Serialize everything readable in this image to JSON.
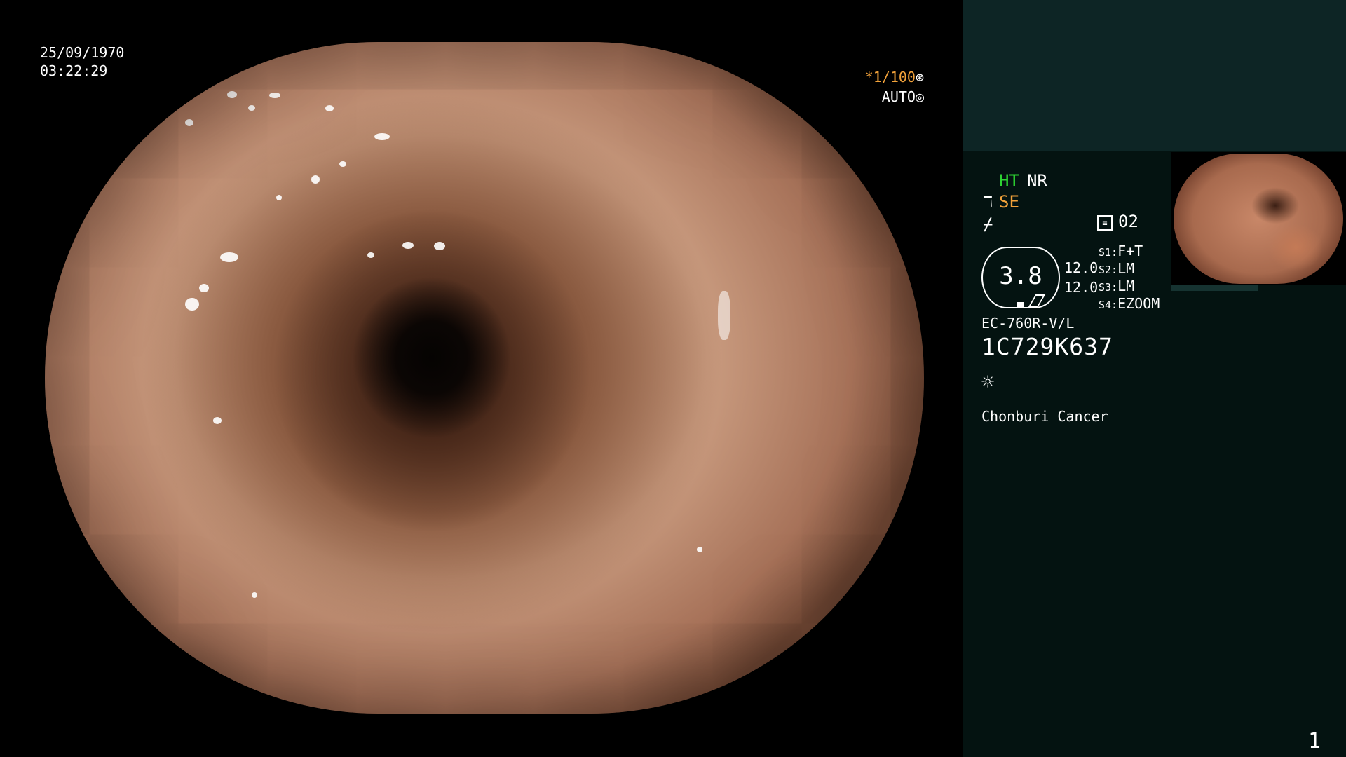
{
  "viewport": {
    "date": "25/09/1970",
    "time": "03:22:29",
    "shutter": "*1/100",
    "shutter_icon": "⊛",
    "auto_label": "AUTO",
    "auto_icon": "◎"
  },
  "panel": {
    "ht": "HT",
    "nr": "NR",
    "se_icon": "ℸ",
    "se": "SE",
    "f_icon": "⌿",
    "mode_icon": "≡",
    "mode_value": "02",
    "gauge_value": "3.8",
    "level_1": "12.0",
    "level_2": "12.0",
    "settings": [
      {
        "key": "S1:",
        "value": "F+T"
      },
      {
        "key": "S2:",
        "value": "LM"
      },
      {
        "key": "S3:",
        "value": "LM"
      },
      {
        "key": "S4:",
        "value": "EZOOM"
      }
    ],
    "model": "EC-760R-V/L",
    "serial": "1C729K637",
    "light_icon": "☼",
    "hospital": "Chonburi Cancer"
  },
  "page_number": "1",
  "colors": {
    "panel_bg": "#041311",
    "panel_top_bg": "#0d2525",
    "ht_green": "#2ed633",
    "accent_orange": "#f2a23a"
  }
}
